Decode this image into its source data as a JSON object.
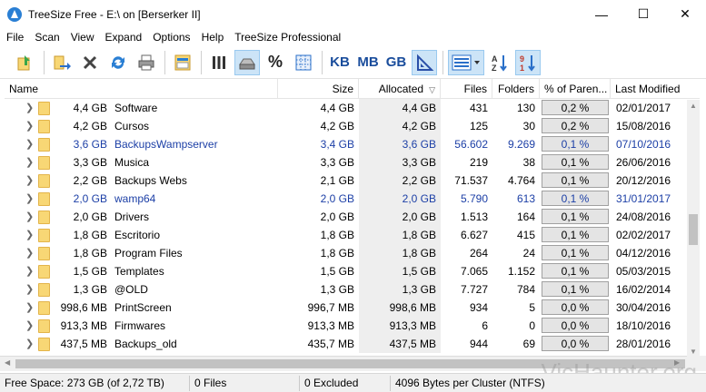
{
  "window": {
    "title": "TreeSize Free - E:\\  on  [Berserker II]",
    "minimize": "—",
    "maximize": "☐",
    "close": "✕"
  },
  "menu": [
    "File",
    "Scan",
    "View",
    "Expand",
    "Options",
    "Help",
    "TreeSize Professional"
  ],
  "toolbar": {
    "kb": "KB",
    "mb": "MB",
    "gb": "GB",
    "percent": "%"
  },
  "columns": {
    "name": "Name",
    "size": "Size",
    "allocated": "Allocated",
    "files": "Files",
    "folders": "Folders",
    "percent": "% of Paren...",
    "modified": "Last Modified"
  },
  "rows": [
    {
      "size": "4,4 GB",
      "name": "Software",
      "size2": "4,4 GB",
      "allocated": "4,4 GB",
      "files": "431",
      "folders": "130",
      "percent": "0,2 %",
      "modified": "02/01/2017",
      "highlight": false
    },
    {
      "size": "4,2 GB",
      "name": "Cursos",
      "size2": "4,2 GB",
      "allocated": "4,2 GB",
      "files": "125",
      "folders": "30",
      "percent": "0,2 %",
      "modified": "15/08/2016",
      "highlight": false
    },
    {
      "size": "3,6 GB",
      "name": "BackupsWampserver",
      "size2": "3,4 GB",
      "allocated": "3,6 GB",
      "files": "56.602",
      "folders": "9.269",
      "percent": "0,1 %",
      "modified": "07/10/2016",
      "highlight": true
    },
    {
      "size": "3,3 GB",
      "name": "Musica",
      "size2": "3,3 GB",
      "allocated": "3,3 GB",
      "files": "219",
      "folders": "38",
      "percent": "0,1 %",
      "modified": "26/06/2016",
      "highlight": false
    },
    {
      "size": "2,2 GB",
      "name": "Backups Webs",
      "size2": "2,1 GB",
      "allocated": "2,2 GB",
      "files": "71.537",
      "folders": "4.764",
      "percent": "0,1 %",
      "modified": "20/12/2016",
      "highlight": false
    },
    {
      "size": "2,0 GB",
      "name": "wamp64",
      "size2": "2,0 GB",
      "allocated": "2,0 GB",
      "files": "5.790",
      "folders": "613",
      "percent": "0,1 %",
      "modified": "31/01/2017",
      "highlight": true
    },
    {
      "size": "2,0 GB",
      "name": "Drivers",
      "size2": "2,0 GB",
      "allocated": "2,0 GB",
      "files": "1.513",
      "folders": "164",
      "percent": "0,1 %",
      "modified": "24/08/2016",
      "highlight": false
    },
    {
      "size": "1,8 GB",
      "name": "Escritorio",
      "size2": "1,8 GB",
      "allocated": "1,8 GB",
      "files": "6.627",
      "folders": "415",
      "percent": "0,1 %",
      "modified": "02/02/2017",
      "highlight": false
    },
    {
      "size": "1,8 GB",
      "name": "Program Files",
      "size2": "1,8 GB",
      "allocated": "1,8 GB",
      "files": "264",
      "folders": "24",
      "percent": "0,1 %",
      "modified": "04/12/2016",
      "highlight": false
    },
    {
      "size": "1,5 GB",
      "name": "Templates",
      "size2": "1,5 GB",
      "allocated": "1,5 GB",
      "files": "7.065",
      "folders": "1.152",
      "percent": "0,1 %",
      "modified": "05/03/2015",
      "highlight": false
    },
    {
      "size": "1,3 GB",
      "name": "@OLD",
      "size2": "1,3 GB",
      "allocated": "1,3 GB",
      "files": "7.727",
      "folders": "784",
      "percent": "0,1 %",
      "modified": "16/02/2014",
      "highlight": false
    },
    {
      "size": "998,6 MB",
      "name": "PrintScreen",
      "size2": "996,7 MB",
      "allocated": "998,6 MB",
      "files": "934",
      "folders": "5",
      "percent": "0,0 %",
      "modified": "30/04/2016",
      "highlight": false
    },
    {
      "size": "913,3 MB",
      "name": "Firmwares",
      "size2": "913,3 MB",
      "allocated": "913,3 MB",
      "files": "6",
      "folders": "0",
      "percent": "0,0 %",
      "modified": "18/10/2016",
      "highlight": false
    },
    {
      "size": "437,5 MB",
      "name": "Backups_old",
      "size2": "435,7 MB",
      "allocated": "437,5 MB",
      "files": "944",
      "folders": "69",
      "percent": "0,0 %",
      "modified": "28/01/2016",
      "highlight": false
    }
  ],
  "colors": {
    "highlight_text": "#1c3fa6",
    "toolbar_active": "#cce4f7"
  },
  "status": {
    "free_space": "Free Space: 273 GB  (of 2,72 TB)",
    "files": "0  Files",
    "excluded": "0 Excluded",
    "cluster": "4096  Bytes per Cluster (NTFS)"
  },
  "watermark": "VicHaunter.org"
}
